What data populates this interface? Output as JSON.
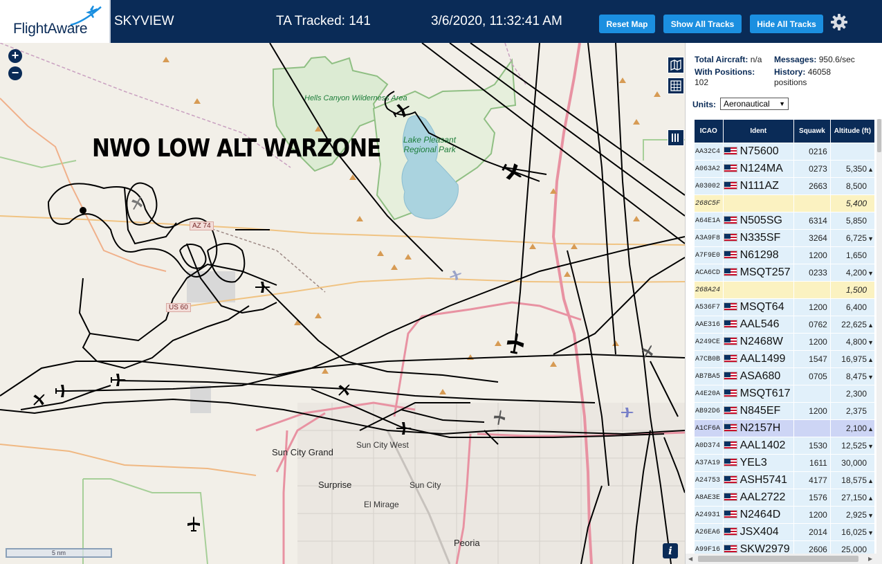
{
  "header": {
    "logo_text": "FlightAware",
    "app_title": "SKYVIEW",
    "ta_tracked": "TA Tracked: 141",
    "datetime": "3/6/2020, 11:32:41 AM",
    "reset_map_label": "Reset Map",
    "show_tracks_label": "Show All Tracks",
    "hide_tracks_label": "Hide All Tracks",
    "settings_icon": "gear-icon"
  },
  "map": {
    "annotation": "NWO LOW ALT WARZONE",
    "zoom_in": "+",
    "zoom_out": "−",
    "scale_label": "5 nm",
    "info_label": "i",
    "labels": {
      "hells_canyon": "Hells Canyon Wilderness Area",
      "lake_pleasant": "Lake Pleasant Regional Park",
      "sun_city_grand": "Sun City Grand",
      "sun_city_west": "Sun City West",
      "sun_city": "Sun City",
      "surprise": "Surprise",
      "el_mirage": "El Mirage",
      "peoria": "Peoria",
      "az74": "AZ 74",
      "us60": "US 60"
    },
    "colors": {
      "land": "#f2efe8",
      "water": "#aad3df",
      "park": "#cbe3c3",
      "highway": "#e892a2",
      "track": "#000000"
    }
  },
  "sidebar": {
    "total_aircraft_label": "Total Aircraft:",
    "total_aircraft_value": "n/a",
    "messages_label": "Messages:",
    "messages_value": "950.6/sec",
    "with_positions_label": "With Positions:",
    "with_positions_value": "102",
    "history_label": "History:",
    "history_value": "46058",
    "history_unit": "positions",
    "units_label": "Units:",
    "units_value": "Aeronautical",
    "columns": [
      "ICAO",
      "Ident",
      "Squawk",
      "Altitude (ft)"
    ],
    "rows": [
      {
        "icao": "AA32C4",
        "ident": "N75600",
        "squawk": "0216",
        "alt": "",
        "trend": ""
      },
      {
        "icao": "A063A2",
        "ident": "N124MA",
        "squawk": "0273",
        "alt": "5,350",
        "trend": "▲"
      },
      {
        "icao": "A03002",
        "ident": "N111AZ",
        "squawk": "2663",
        "alt": "8,500",
        "trend": ""
      },
      {
        "icao": "268C5F",
        "ident": "",
        "squawk": "",
        "alt": "5,400",
        "trend": "",
        "style": "yellow"
      },
      {
        "icao": "A64E1A",
        "ident": "N505SG",
        "squawk": "6314",
        "alt": "5,850",
        "trend": ""
      },
      {
        "icao": "A3A9F8",
        "ident": "N335SF",
        "squawk": "3264",
        "alt": "6,725",
        "trend": "▼"
      },
      {
        "icao": "A7F9E0",
        "ident": "N61298",
        "squawk": "1200",
        "alt": "1,650",
        "trend": ""
      },
      {
        "icao": "ACA6CD",
        "ident": "MSQT257",
        "squawk": "0233",
        "alt": "4,200",
        "trend": "▼"
      },
      {
        "icao": "268A24",
        "ident": "",
        "squawk": "",
        "alt": "1,500",
        "trend": "",
        "style": "yellow"
      },
      {
        "icao": "A536F7",
        "ident": "MSQT64",
        "squawk": "1200",
        "alt": "6,400",
        "trend": ""
      },
      {
        "icao": "AAE316",
        "ident": "AAL546",
        "squawk": "0762",
        "alt": "22,625",
        "trend": "▲"
      },
      {
        "icao": "A249CE",
        "ident": "N2468W",
        "squawk": "1200",
        "alt": "4,800",
        "trend": "▼"
      },
      {
        "icao": "A7CB0B",
        "ident": "AAL1499",
        "squawk": "1547",
        "alt": "16,975",
        "trend": "▲"
      },
      {
        "icao": "AB7BA5",
        "ident": "ASA680",
        "squawk": "0705",
        "alt": "8,475",
        "trend": "▼"
      },
      {
        "icao": "A4E20A",
        "ident": "MSQT617",
        "squawk": "",
        "alt": "2,300",
        "trend": ""
      },
      {
        "icao": "AB92D6",
        "ident": "N845EF",
        "squawk": "1200",
        "alt": "2,375",
        "trend": ""
      },
      {
        "icao": "A1CF6A",
        "ident": "N2157H",
        "squawk": "",
        "alt": "2,100",
        "trend": "▲",
        "style": "sel"
      },
      {
        "icao": "A0D374",
        "ident": "AAL1402",
        "squawk": "1530",
        "alt": "12,525",
        "trend": "▼"
      },
      {
        "icao": "A37A19",
        "ident": "YEL3",
        "squawk": "1611",
        "alt": "30,000",
        "trend": ""
      },
      {
        "icao": "A24753",
        "ident": "ASH5741",
        "squawk": "4177",
        "alt": "18,575",
        "trend": "▲"
      },
      {
        "icao": "A8AE3E",
        "ident": "AAL2722",
        "squawk": "1576",
        "alt": "27,150",
        "trend": "▲"
      },
      {
        "icao": "A24931",
        "ident": "N2464D",
        "squawk": "1200",
        "alt": "2,925",
        "trend": "▼"
      },
      {
        "icao": "A26EA6",
        "ident": "JSX404",
        "squawk": "2014",
        "alt": "16,025",
        "trend": "▼"
      },
      {
        "icao": "A99F16",
        "ident": "SKW2979",
        "squawk": "2606",
        "alt": "25,000",
        "trend": ""
      }
    ]
  }
}
